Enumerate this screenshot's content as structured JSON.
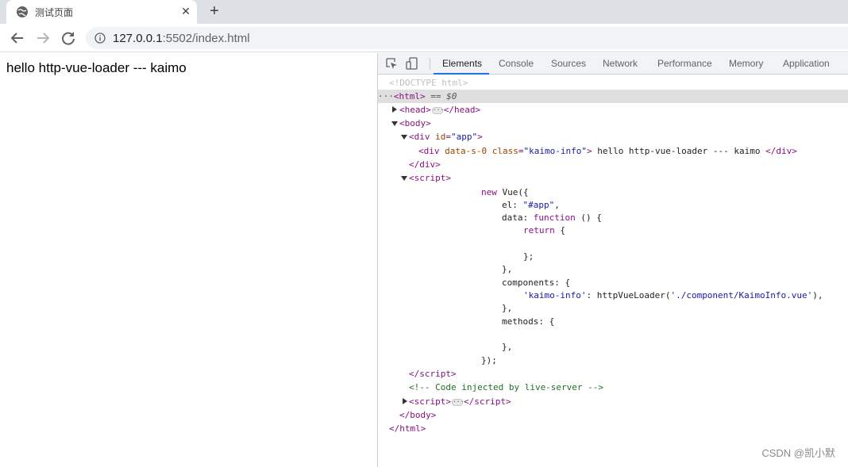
{
  "tab": {
    "title": "测试页面",
    "close": "✕",
    "new_tab": "+"
  },
  "address": {
    "host": "127.0.0.1",
    "rest": ":5502/index.html"
  },
  "page": {
    "text": "hello http-vue-loader --- kaimo"
  },
  "devtools": {
    "tabs": [
      "Elements",
      "Console",
      "Sources",
      "Network",
      "Performance",
      "Memory",
      "Application"
    ],
    "active_tab": "Elements"
  },
  "dom": {
    "doctype": "<!DOCTYPE html>",
    "html_selected_suffix": " == $0",
    "div_text": " hello http-vue-loader --- kaimo ",
    "comment": "<!-- Code injected by live-server -->"
  },
  "watermark": "CSDN @凯小默",
  "colors": {
    "accent": "#1a73e8",
    "tag": "#881280",
    "attr": "#994500",
    "value": "#1a1aa6",
    "comment": "#236e25"
  }
}
